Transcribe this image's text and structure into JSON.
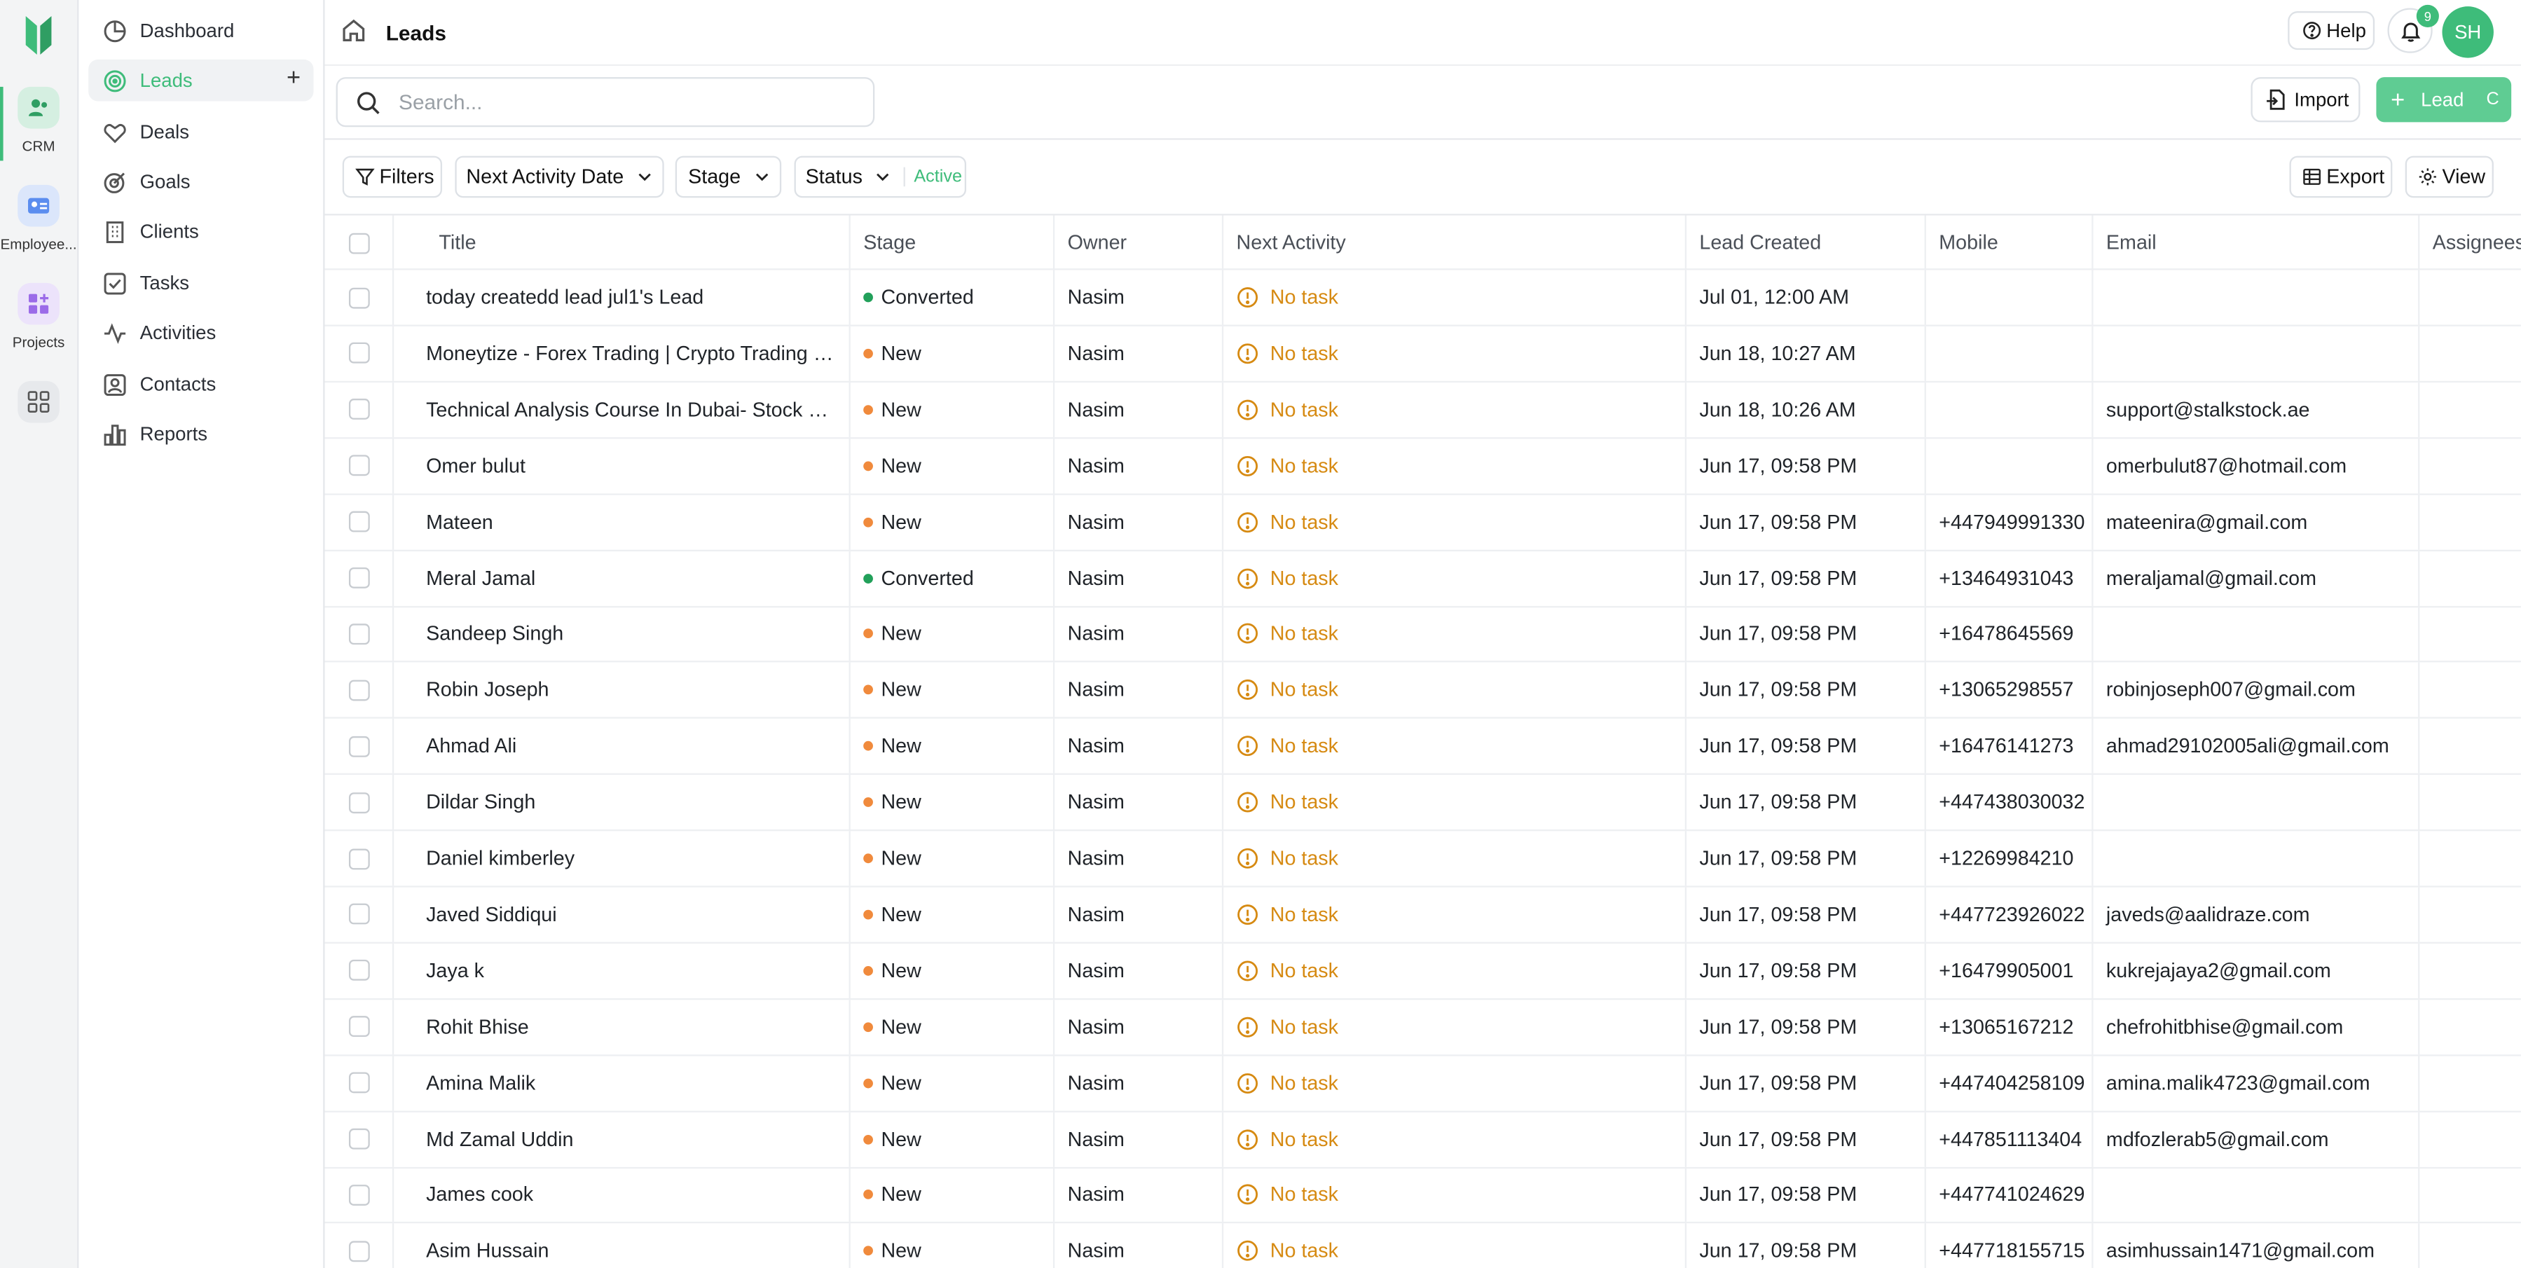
{
  "rail": {
    "items": [
      {
        "label": "CRM",
        "icon": "crm-users-icon"
      },
      {
        "label": "Employee...",
        "icon": "employee-card-icon"
      },
      {
        "label": "Projects",
        "icon": "projects-icon"
      },
      {
        "label": "",
        "icon": "apps-grid-icon"
      }
    ]
  },
  "sidebar": {
    "items": [
      {
        "label": "Dashboard",
        "icon": "dashboard-icon"
      },
      {
        "label": "Leads",
        "icon": "target-icon"
      },
      {
        "label": "Deals",
        "icon": "handshake-icon"
      },
      {
        "label": "Goals",
        "icon": "goals-icon"
      },
      {
        "label": "Clients",
        "icon": "building-icon"
      },
      {
        "label": "Tasks",
        "icon": "task-check-icon"
      },
      {
        "label": "Activities",
        "icon": "activity-icon"
      },
      {
        "label": "Contacts",
        "icon": "contacts-icon"
      },
      {
        "label": "Reports",
        "icon": "reports-icon"
      }
    ],
    "add_symbol": "+"
  },
  "header": {
    "title": "Leads",
    "help_label": "Help",
    "notification_count": "9",
    "avatar_initials": "SH"
  },
  "search": {
    "placeholder": "Search...",
    "value": ""
  },
  "actions": {
    "import_label": "Import",
    "add_lead_label": "Lead",
    "add_lead_shortcut": "C",
    "export_label": "Export",
    "view_label": "View"
  },
  "filters": {
    "filters_label": "Filters",
    "next_activity_label": "Next Activity Date",
    "stage_label": "Stage",
    "status_label": "Status",
    "status_value": "Active"
  },
  "colors": {
    "accent": "#3ebc7a",
    "converted_dot": "#22a05a",
    "new_dot": "#f08a3c",
    "no_task": "#d68a12"
  },
  "table": {
    "columns": [
      "Title",
      "Stage",
      "Owner",
      "Next Activity",
      "Lead Created",
      "Mobile",
      "Email",
      "Assignees"
    ],
    "rows": [
      {
        "title": "today createdd lead jul1's Lead",
        "stage": "Converted",
        "owner": "Nasim",
        "next_activity": "No task",
        "created": "Jul 01, 12:00 AM",
        "mobile": "",
        "email": ""
      },
      {
        "title": "Moneytize - Forex Trading | Crypto Trading | ...",
        "stage": "New",
        "owner": "Nasim",
        "next_activity": "No task",
        "created": "Jun 18, 10:27 AM",
        "mobile": "",
        "email": ""
      },
      {
        "title": "Technical Analysis Course In Dubai- Stock M...",
        "stage": "New",
        "owner": "Nasim",
        "next_activity": "No task",
        "created": "Jun 18, 10:26 AM",
        "mobile": "",
        "email": "support@stalkstock.ae"
      },
      {
        "title": "Omer bulut",
        "stage": "New",
        "owner": "Nasim",
        "next_activity": "No task",
        "created": "Jun 17, 09:58 PM",
        "mobile": "",
        "email": "omerbulut87@hotmail.com"
      },
      {
        "title": "Mateen",
        "stage": "New",
        "owner": "Nasim",
        "next_activity": "No task",
        "created": "Jun 17, 09:58 PM",
        "mobile": "+447949991330",
        "email": "mateenira@gmail.com"
      },
      {
        "title": "Meral Jamal",
        "stage": "Converted",
        "owner": "Nasim",
        "next_activity": "No task",
        "created": "Jun 17, 09:58 PM",
        "mobile": "+13464931043",
        "email": "meraljamal@gmail.com"
      },
      {
        "title": "Sandeep Singh",
        "stage": "New",
        "owner": "Nasim",
        "next_activity": "No task",
        "created": "Jun 17, 09:58 PM",
        "mobile": "+16478645569",
        "email": ""
      },
      {
        "title": "Robin Joseph",
        "stage": "New",
        "owner": "Nasim",
        "next_activity": "No task",
        "created": "Jun 17, 09:58 PM",
        "mobile": "+13065298557",
        "email": "robinjoseph007@gmail.com"
      },
      {
        "title": "Ahmad Ali",
        "stage": "New",
        "owner": "Nasim",
        "next_activity": "No task",
        "created": "Jun 17, 09:58 PM",
        "mobile": "+16476141273",
        "email": "ahmad29102005ali@gmail.com"
      },
      {
        "title": "Dildar Singh",
        "stage": "New",
        "owner": "Nasim",
        "next_activity": "No task",
        "created": "Jun 17, 09:58 PM",
        "mobile": "+447438030032",
        "email": ""
      },
      {
        "title": "Daniel kimberley",
        "stage": "New",
        "owner": "Nasim",
        "next_activity": "No task",
        "created": "Jun 17, 09:58 PM",
        "mobile": "+12269984210",
        "email": ""
      },
      {
        "title": "Javed Siddiqui",
        "stage": "New",
        "owner": "Nasim",
        "next_activity": "No task",
        "created": "Jun 17, 09:58 PM",
        "mobile": "+447723926022",
        "email": "javeds@aalidraze.com"
      },
      {
        "title": "Jaya k",
        "stage": "New",
        "owner": "Nasim",
        "next_activity": "No task",
        "created": "Jun 17, 09:58 PM",
        "mobile": "+16479905001",
        "email": "kukrejajaya2@gmail.com"
      },
      {
        "title": "Rohit Bhise",
        "stage": "New",
        "owner": "Nasim",
        "next_activity": "No task",
        "created": "Jun 17, 09:58 PM",
        "mobile": "+13065167212",
        "email": "chefrohitbhise@gmail.com"
      },
      {
        "title": "Amina Malik",
        "stage": "New",
        "owner": "Nasim",
        "next_activity": "No task",
        "created": "Jun 17, 09:58 PM",
        "mobile": "+447404258109",
        "email": "amina.malik4723@gmail.com"
      },
      {
        "title": "Md Zamal Uddin",
        "stage": "New",
        "owner": "Nasim",
        "next_activity": "No task",
        "created": "Jun 17, 09:58 PM",
        "mobile": "+447851113404",
        "email": "mdfozlerab5@gmail.com"
      },
      {
        "title": "James cook",
        "stage": "New",
        "owner": "Nasim",
        "next_activity": "No task",
        "created": "Jun 17, 09:58 PM",
        "mobile": "+447741024629",
        "email": ""
      },
      {
        "title": "Asim Hussain",
        "stage": "New",
        "owner": "Nasim",
        "next_activity": "No task",
        "created": "Jun 17, 09:58 PM",
        "mobile": "+447718155715",
        "email": "asimhussain1471@gmail.com"
      }
    ]
  }
}
